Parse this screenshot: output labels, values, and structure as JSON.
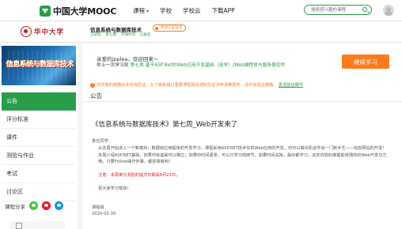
{
  "topnav": {
    "logo_text": "中国大学MOOC",
    "links": [
      "课程",
      "学校",
      "学校云",
      "下载APP"
    ],
    "search_placeholder": "搜索感兴趣的课程"
  },
  "coursebar": {
    "school_name": "华中大学",
    "course_title": "信息系统与数据库技术",
    "meta": [
      "方晓瑞",
      "第七期",
      "开课时间",
      "已报名"
    ],
    "cert_badge": "申请认证证书"
  },
  "sidebar": {
    "banner_text": "信息系统与数据库技术",
    "items": [
      "公告",
      "评分标准",
      "课件",
      "测验与作业",
      "考试",
      "讨论区"
    ],
    "share_label": "课程分享"
  },
  "welcome": {
    "greeting": "亲爱的jpplea，欢迎回来～",
    "last_study_prefix": "你上一次学习到",
    "last_study_link": "第七周 基于ASP.Net的Web应用开发基础（选学）/Web编程体与服务器控件",
    "continue_button": "继续学习",
    "notice": "你所用的邮箱尚未完成验证。为了避免错过重要课程相关通知及证书申请等服务，请尽快验证邮箱。",
    "notice_link": "发送验证邮件"
  },
  "section": {
    "title": "公告"
  },
  "announcement": {
    "title": "《信息系统与数据库技术》第七周_Web开发来了",
    "salutation": "各位同学：",
    "para1": "从本周开始进入一个新模块，数据库应用程序的开发学习。课程采用ASP.NET技术实现Web应用的开发。你可以做出机会学会一门新手艺——动态网站的开发！",
    "para2": "本周介绍ASP.NET基础，如果你有基础可以略过；如果你时间紧张，可以只学习前两节。如果时间充裕，最好都学习，这些内容的掌握能增强你的Web开发功力哦。只要Follow操作步骤，都容易做到！",
    "deadline": "注意：本周单元测验的提交日期是6月21日。",
    "closing": "祝大家学习愉快！",
    "signature": "课程组",
    "date": "2020-03-30"
  }
}
